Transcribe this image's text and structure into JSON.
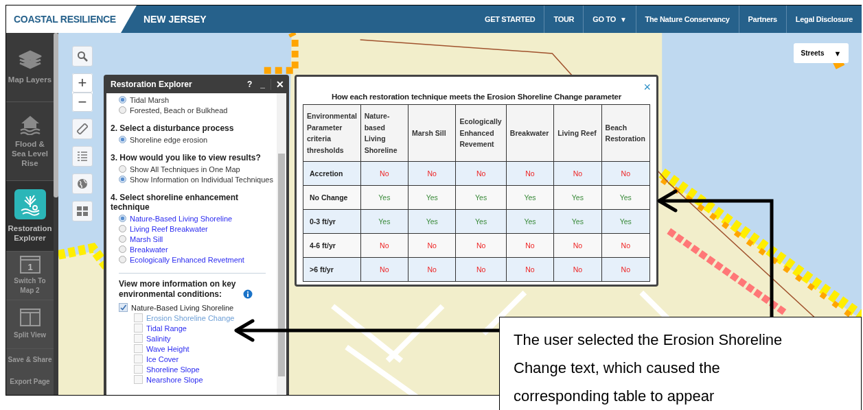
{
  "header": {
    "brand": "COASTAL RESILIENCE",
    "region": "NEW JERSEY",
    "nav": [
      {
        "label": "GET STARTED"
      },
      {
        "label": "TOUR"
      },
      {
        "label": "GO TO",
        "caret": "▼"
      },
      {
        "label": "The Nature Conservancy"
      },
      {
        "label": "Partners"
      },
      {
        "label": "Legal Disclosure"
      }
    ]
  },
  "sidebar": {
    "items": [
      {
        "kind": "layers",
        "label": "Map Layers",
        "selected": false
      },
      {
        "kind": "flood",
        "label": "Flood & Sea Level Rise",
        "selected": false
      },
      {
        "kind": "restoration",
        "label": "Restoration Explorer",
        "selected": true
      },
      {
        "kind": "window",
        "label": "Switch To Map 2",
        "icon_text": "1",
        "selected": false
      },
      {
        "kind": "split",
        "label": "Split View",
        "selected": false
      },
      {
        "kind": "text",
        "label": "Save & Share",
        "selected": false
      },
      {
        "kind": "text",
        "label": "Export Page",
        "selected": false
      }
    ]
  },
  "map_tools": [
    {
      "kind": "search"
    },
    {
      "kind": "zoom",
      "zoom_in": "+",
      "zoom_out": "−"
    },
    {
      "kind": "ruler"
    },
    {
      "kind": "legend"
    },
    {
      "kind": "globe"
    },
    {
      "kind": "grid"
    }
  ],
  "basemap": {
    "label": "Streets",
    "caret": "▼"
  },
  "panel": {
    "title": "Restoration Explorer",
    "help": "?",
    "minimize": "_",
    "close": "✕",
    "sections": [
      {
        "kind": "radio",
        "options": [
          {
            "label": "Tidal Marsh",
            "selected": true
          },
          {
            "label": "Forested, Beach or Bulkhead",
            "selected": false
          }
        ]
      },
      {
        "kind": "radio",
        "heading": "2. Select a disturbance process",
        "options": [
          {
            "label": "Shoreline edge erosion",
            "selected": true
          }
        ]
      },
      {
        "kind": "radio",
        "heading": "3. How would you like to view results?",
        "options": [
          {
            "label": "Show All Techniques in One Map",
            "selected": false
          },
          {
            "label": "Show Information on Individual Techniques",
            "selected": true
          }
        ]
      },
      {
        "kind": "link",
        "heading": "4. Select shoreline enhancement technique",
        "options": [
          {
            "label": "Nature-Based Living Shoreline",
            "selected": true
          },
          {
            "label": "Living Reef Breakwater",
            "selected": false
          },
          {
            "label": "Marsh Sill",
            "selected": false
          },
          {
            "label": "Breakwater",
            "selected": false
          },
          {
            "label": "Ecologically Enhanced Revetment",
            "selected": false
          }
        ]
      }
    ],
    "info": {
      "heading": "View more information on key environmental conditions:",
      "layer": {
        "label": "Nature-Based Living Shoreline",
        "checked": true,
        "children": [
          {
            "label": "Erosion Shoreline Change",
            "checked": false,
            "selected": true
          },
          {
            "label": "Tidal Range",
            "checked": false,
            "selected": false
          },
          {
            "label": "Salinity",
            "checked": false,
            "selected": false
          },
          {
            "label": "Wave Height",
            "checked": false,
            "selected": false
          },
          {
            "label": "Ice Cover",
            "checked": false,
            "selected": false
          },
          {
            "label": "Shoreline Slope",
            "checked": false,
            "selected": false
          },
          {
            "label": "Nearshore Slope",
            "checked": false,
            "selected": false
          }
        ]
      }
    }
  },
  "popup": {
    "title": "How each restoration technique meets the Erosion Shoreline Change parameter",
    "close": "×",
    "columns": [
      "Environmental Parameter criteria thresholds",
      "Nature-based Living Shoreline",
      "Marsh Sill",
      "Ecologically Enhanced Revement",
      "Breakwater",
      "Living Reef",
      "Beach Restoration"
    ],
    "rows": [
      {
        "met": false,
        "cells": [
          "Accretion",
          "No",
          "No",
          "No",
          "No",
          "No",
          "No"
        ]
      },
      {
        "met": true,
        "cells": [
          "No Change",
          "Yes",
          "Yes",
          "Yes",
          "Yes",
          "Yes",
          "Yes"
        ]
      },
      {
        "met": true,
        "cells": [
          "0-3 ft/yr",
          "Yes",
          "Yes",
          "Yes",
          "Yes",
          "Yes",
          "Yes"
        ]
      },
      {
        "met": false,
        "cells": [
          "4-6 ft/yr",
          "No",
          "No",
          "No",
          "No",
          "No",
          "No"
        ]
      },
      {
        "met": false,
        "cells": [
          ">6 ft/yr",
          "No",
          "No",
          "No",
          "No",
          "No",
          "No"
        ]
      }
    ]
  },
  "callout": {
    "text": "The user selected the Erosion Shoreline Change text, which caused the corresponding table to appear"
  }
}
